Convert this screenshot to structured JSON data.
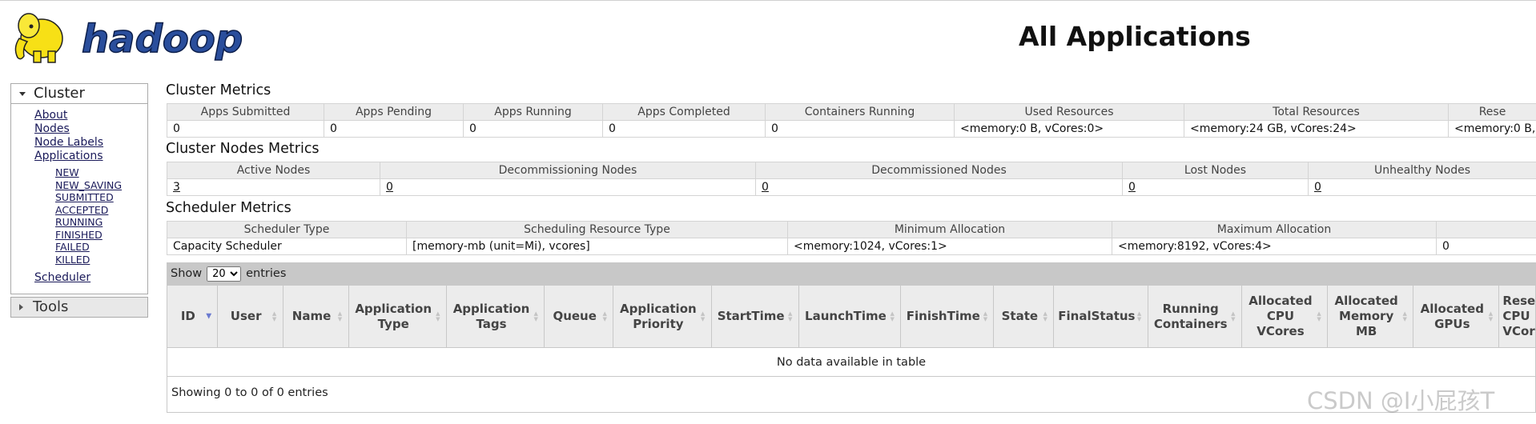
{
  "header": {
    "logo_text": "hadoop",
    "page_title": "All Applications"
  },
  "sidebar": {
    "cluster_label": "Cluster",
    "items": [
      "About",
      "Nodes",
      "Node Labels",
      "Applications"
    ],
    "app_states": [
      "NEW",
      "NEW_SAVING",
      "SUBMITTED",
      "ACCEPTED",
      "RUNNING",
      "FINISHED",
      "FAILED",
      "KILLED"
    ],
    "scheduler_label": "Scheduler",
    "tools_label": "Tools"
  },
  "cluster_metrics": {
    "title": "Cluster Metrics",
    "headers": [
      "Apps Submitted",
      "Apps Pending",
      "Apps Running",
      "Apps Completed",
      "Containers Running",
      "Used Resources",
      "Total Resources",
      "Rese"
    ],
    "values": [
      "0",
      "0",
      "0",
      "0",
      "0",
      "<memory:0 B, vCores:0>",
      "<memory:24 GB, vCores:24>",
      "<memory:0 B,"
    ]
  },
  "nodes_metrics": {
    "title": "Cluster Nodes Metrics",
    "headers": [
      "Active Nodes",
      "Decommissioning Nodes",
      "Decommissioned Nodes",
      "Lost Nodes",
      "Unhealthy Nodes"
    ],
    "values": [
      "3",
      "0",
      "0",
      "0",
      "0"
    ]
  },
  "scheduler_metrics": {
    "title": "Scheduler Metrics",
    "headers": [
      "Scheduler Type",
      "Scheduling Resource Type",
      "Minimum Allocation",
      "Maximum Allocation",
      ""
    ],
    "values": [
      "Capacity Scheduler",
      "[memory-mb (unit=Mi), vcores]",
      "<memory:1024, vCores:1>",
      "<memory:8192, vCores:4>",
      "0"
    ]
  },
  "apps": {
    "show_label": "Show",
    "page_size": "20",
    "entries_label": "entries",
    "columns": [
      "ID",
      "User",
      "Name",
      "Application Type",
      "Application Tags",
      "Queue",
      "Application Priority",
      "StartTime",
      "LaunchTime",
      "FinishTime",
      "State",
      "FinalStatus",
      "Running Containers",
      "Allocated CPU VCores",
      "Allocated Memory MB",
      "Allocated GPUs",
      "Reserved CPU VCores"
    ],
    "empty_message": "No data available in table",
    "footer": "Showing 0 to 0 of 0 entries"
  },
  "watermark": "CSDN @I小屁孩T"
}
